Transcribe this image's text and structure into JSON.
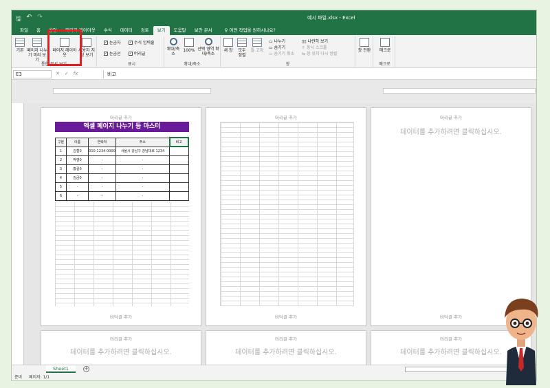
{
  "titlebar": {
    "save_icon": "save-icon",
    "undo_icon": "undo-icon",
    "redo_icon": "redo-icon",
    "title": "예시 파일.xlsx  -  Excel"
  },
  "tabs": [
    "파일",
    "홈",
    "삽입",
    "페이지 레이아웃",
    "수식",
    "데이터",
    "검토",
    "보기",
    "도움말",
    "보안 문서"
  ],
  "active_tab": "보기",
  "tell_me": "어떤 작업을 원하시나요?",
  "ribbon": {
    "workbook_views": {
      "label": "통합 문서 보기",
      "normal": "기본",
      "page_break": "페이지 나누기 미리 보기",
      "page_layout": "페이지 레이아웃",
      "custom": "사용자 지정 보기"
    },
    "show": {
      "label": "표시",
      "ruler": "눈금자",
      "formula_bar": "수식 입력줄",
      "gridlines": "눈금선",
      "headings": "머리글"
    },
    "zoom": {
      "label": "확대/축소",
      "zoom": "확대/축소",
      "hundred": "100%",
      "zoom_selection": "선택 영역 확대/축소"
    },
    "window": {
      "label": "창",
      "new_window": "새 창",
      "arrange_all": "모두 정렬",
      "freeze": "틀 고정",
      "split": "나누기",
      "hide": "숨기기",
      "unhide": "숨기기 취소",
      "side_by_side": "나란히 보기",
      "sync_scroll": "동시 스크롤",
      "reset_position": "창 위치 다시 정렬",
      "switch": "창 전환"
    },
    "macros": {
      "label": "매크로",
      "macros": "매크로"
    }
  },
  "formula_bar": {
    "name_box": "E3",
    "cancel": "✕",
    "enter": "✓",
    "fx": "fx",
    "value": "비고"
  },
  "pages": {
    "header_add": "머리글 추가",
    "footer_add": "바닥글 추가",
    "click_to_add": "데이터를 추가하려면 클릭하십시오."
  },
  "sheet": {
    "banner": "엑셀 페이지 나누기 등 마스터",
    "headers": [
      "구분",
      "이름",
      "연락처",
      "주소",
      "비고"
    ],
    "rows": [
      [
        "1",
        "김철0",
        "010-1234-0000",
        "서울시 강남구 강남대로 1234",
        ""
      ],
      [
        "2",
        "박영0",
        "-",
        "-",
        ""
      ],
      [
        "3",
        "홍길0",
        "-",
        "-",
        ""
      ],
      [
        "4",
        "김금0",
        "-",
        "-",
        ""
      ],
      [
        "5",
        "-",
        "-",
        "-",
        ""
      ],
      [
        "6",
        "-",
        "-",
        "-",
        ""
      ]
    ]
  },
  "sheet_tab": "Sheet1",
  "status": {
    "mode": "준비",
    "page": "페이지: 1/1"
  },
  "colors": {
    "excel_green": "#217346",
    "banner_purple": "#6a1b9a",
    "highlight_red": "#e02020"
  }
}
